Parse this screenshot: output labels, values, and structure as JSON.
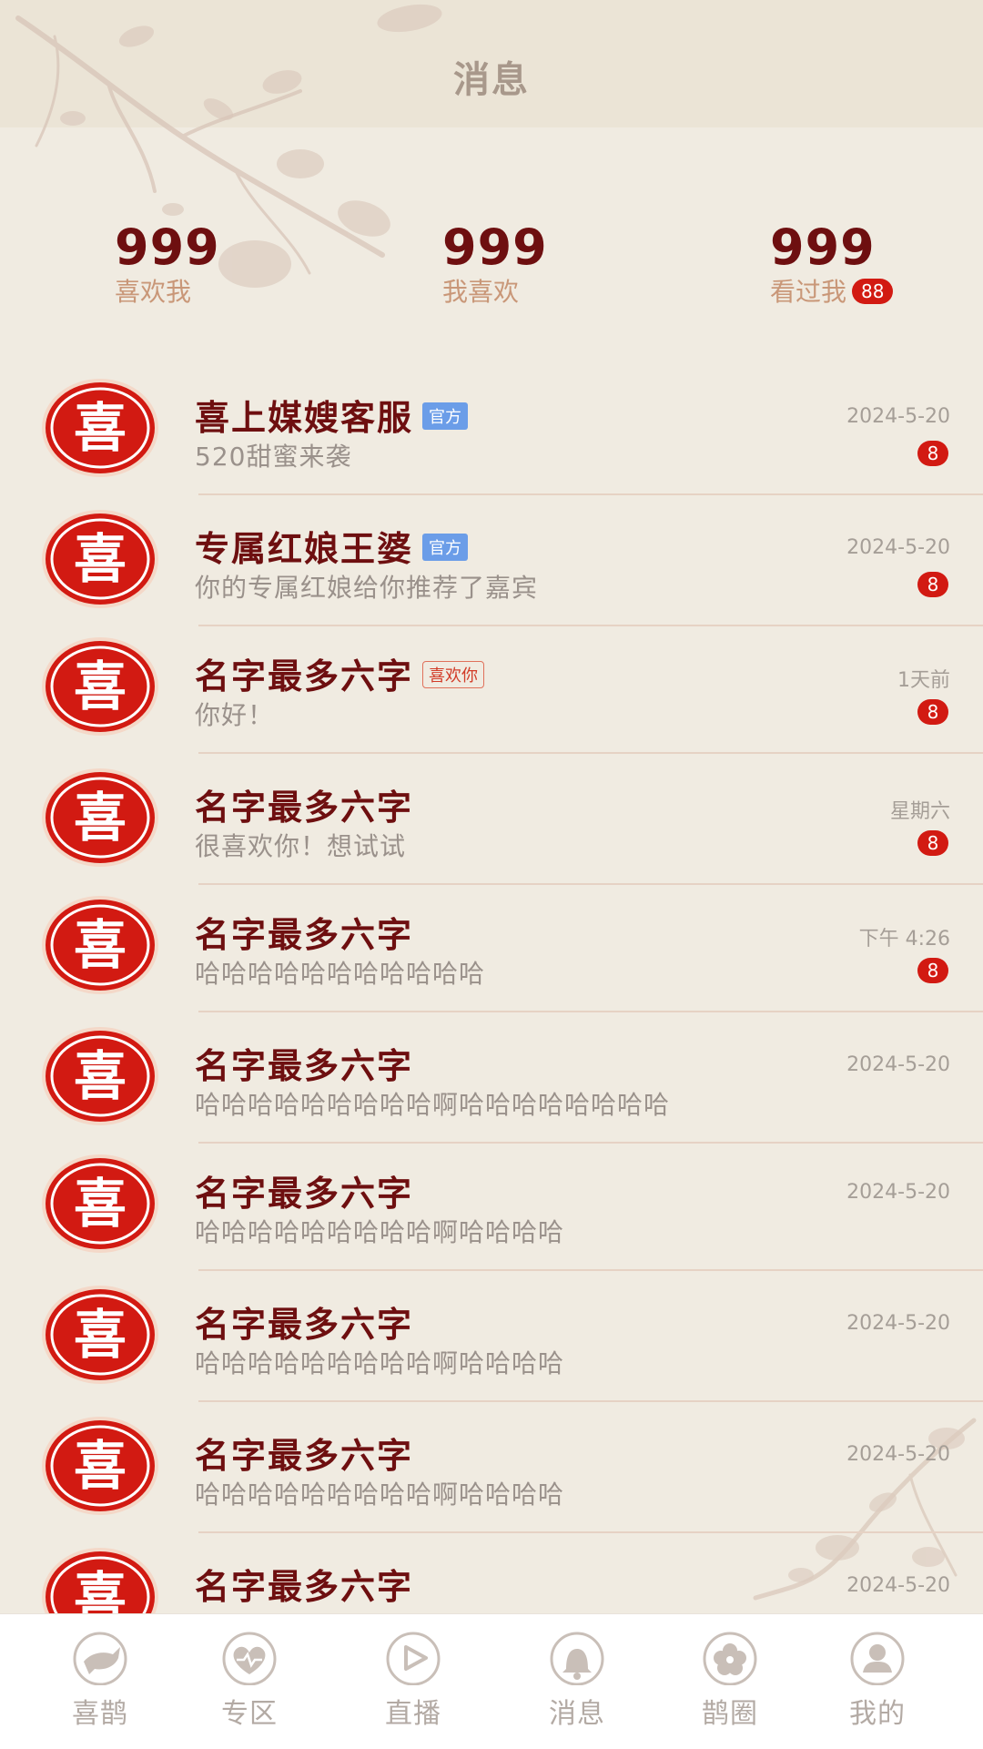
{
  "header": {
    "title": "消息"
  },
  "stats": [
    {
      "count": "999",
      "label": "喜欢我",
      "badge": ""
    },
    {
      "count": "999",
      "label": "我喜欢",
      "badge": ""
    },
    {
      "count": "999",
      "label": "看过我",
      "badge": "88"
    }
  ],
  "avatar_glyph": "喜",
  "messages": [
    {
      "name": "喜上媒嫂客服",
      "tag": "官方",
      "tag_type": "official",
      "preview": "520甜蜜来袭",
      "time": "2024-5-20",
      "badge": "8"
    },
    {
      "name": "专属红娘王婆",
      "tag": "官方",
      "tag_type": "official",
      "preview": "你的专属红娘给你推荐了嘉宾",
      "time": "2024-5-20",
      "badge": "8"
    },
    {
      "name": "名字最多六字",
      "tag": "喜欢你",
      "tag_type": "like",
      "preview": "你好！",
      "time": "1天前",
      "badge": "8"
    },
    {
      "name": "名字最多六字",
      "tag": "",
      "tag_type": "",
      "preview": "很喜欢你！想试试",
      "time": "星期六",
      "badge": "8"
    },
    {
      "name": "名字最多六字",
      "tag": "",
      "tag_type": "",
      "preview": "哈哈哈哈哈哈哈哈哈哈哈",
      "time": "下午 4:26",
      "badge": "8"
    },
    {
      "name": "名字最多六字",
      "tag": "",
      "tag_type": "",
      "preview": "哈哈哈哈哈哈哈哈哈啊哈哈哈哈哈哈哈哈",
      "time": "2024-5-20",
      "badge": ""
    },
    {
      "name": "名字最多六字",
      "tag": "",
      "tag_type": "",
      "preview": "哈哈哈哈哈哈哈哈哈啊哈哈哈哈",
      "time": "2024-5-20",
      "badge": ""
    },
    {
      "name": "名字最多六字",
      "tag": "",
      "tag_type": "",
      "preview": "哈哈哈哈哈哈哈哈哈啊哈哈哈哈",
      "time": "2024-5-20",
      "badge": ""
    },
    {
      "name": "名字最多六字",
      "tag": "",
      "tag_type": "",
      "preview": "哈哈哈哈哈哈哈哈哈啊哈哈哈哈",
      "time": "2024-5-20",
      "badge": ""
    },
    {
      "name": "名字最多六字",
      "tag": "",
      "tag_type": "",
      "preview": "",
      "time": "2024-5-20",
      "badge": ""
    }
  ],
  "tabs": [
    {
      "label": "喜鹊",
      "icon": "magpie-icon"
    },
    {
      "label": "专区",
      "icon": "heart-pulse-icon"
    },
    {
      "label": "直播",
      "icon": "play-icon"
    },
    {
      "label": "消息",
      "icon": "bell-icon"
    },
    {
      "label": "鹊圈",
      "icon": "flower-icon"
    },
    {
      "label": "我的",
      "icon": "user-icon"
    }
  ],
  "colors": {
    "background": "#f0ebe1",
    "header_bg": "#ebe4d6",
    "name": "#6e0f10",
    "stat_label": "#c99778",
    "badge": "#d21a12",
    "official_tag": "#6b9de8",
    "like_tag": "#d23c28",
    "preview": "#9a918b",
    "tab_inactive": "#b3aaa4"
  }
}
